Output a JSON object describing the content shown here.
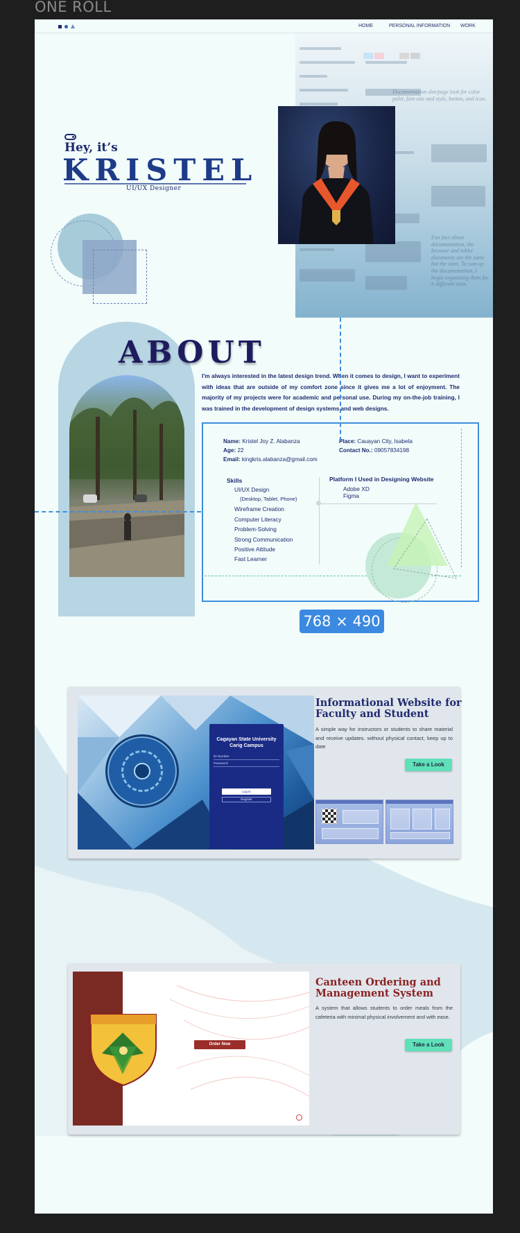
{
  "canvas": {
    "frame_label": "ONE ROLL"
  },
  "nav": {
    "links": [
      "HOME",
      "PERSONAL INFORMATION",
      "WORK"
    ]
  },
  "hero": {
    "greeting": "Hey, it’s",
    "name": "KRISTEL",
    "role": "UI/UX Designer"
  },
  "about": {
    "title": "ABOUT",
    "paragraph": "I'm always interested in the latest design trend. When it comes to design, I want to experiment with ideas that are outside of my comfort zone since it gives me a lot of enjoyment. The majority of my projects were for academic and personal use. During my on-the-job training, I was trained in the development of design systems and web designs.",
    "details": {
      "name_label": "Name:",
      "name_value": "Kristel Joy Z. Alabanza",
      "age_label": "Age:",
      "age_value": "22",
      "email_label": "Email:",
      "email_value": "kingkris.alabanza@gmail.com",
      "place_label": "Place:",
      "place_value": "Cauayan City, Isabela",
      "contact_label": "Contact No.:",
      "contact_value": "09057834198"
    },
    "skills_heading": "Skills",
    "skills": [
      "UI/UX Design",
      "(Desktop, Tablet, Phone)",
      "Wireframe Creation",
      "Computer Literacy",
      "Problem-Solving",
      "Strong Communication",
      "Positive Attitude",
      "Fast Learner"
    ],
    "platform_heading": "Platform I Used in Designing Website",
    "platforms": [
      "Adobe XD",
      "Figma"
    ],
    "dimension_badge": "768 × 490"
  },
  "projects": [
    {
      "title_line1": "Informational Website for",
      "title_line2": "Faculty and Student",
      "description": "A simple way for instructors or students to share material and receive updates. without physical contact, keep up to date",
      "button": "Take a Look",
      "title_color": "#1e2a6e",
      "screenshot": {
        "heading_line1": "Cagayan State University",
        "heading_line2": "Carig Campus",
        "id_label": "ID Number",
        "password_label": "Password",
        "login_button": "Log in",
        "register_button": "Register"
      }
    },
    {
      "title_line1": "Canteen Ordering and",
      "title_line2": "Management System",
      "description": "A system that allows students to order meals from the cafeteria with minimal physical involvement and with ease.",
      "button": "Take a Look",
      "title_color": "#8a2323",
      "screenshot": {
        "order_button": "Order Now"
      }
    }
  ],
  "mock_panel": {
    "note_top": "Documentation slot/page look for color palet, font size and style, button, and icon.",
    "note_side": "Fun fact about documentation, the browser and tablet documents are the same but the sizes. To sum up the documentation, I begin organizing them for it different sizes."
  },
  "colors": {
    "frame_bg": "#f2fcfb",
    "accent_blue": "#3b89e0",
    "navy": "#1e2a6e",
    "mint": "#5fe0b9"
  }
}
